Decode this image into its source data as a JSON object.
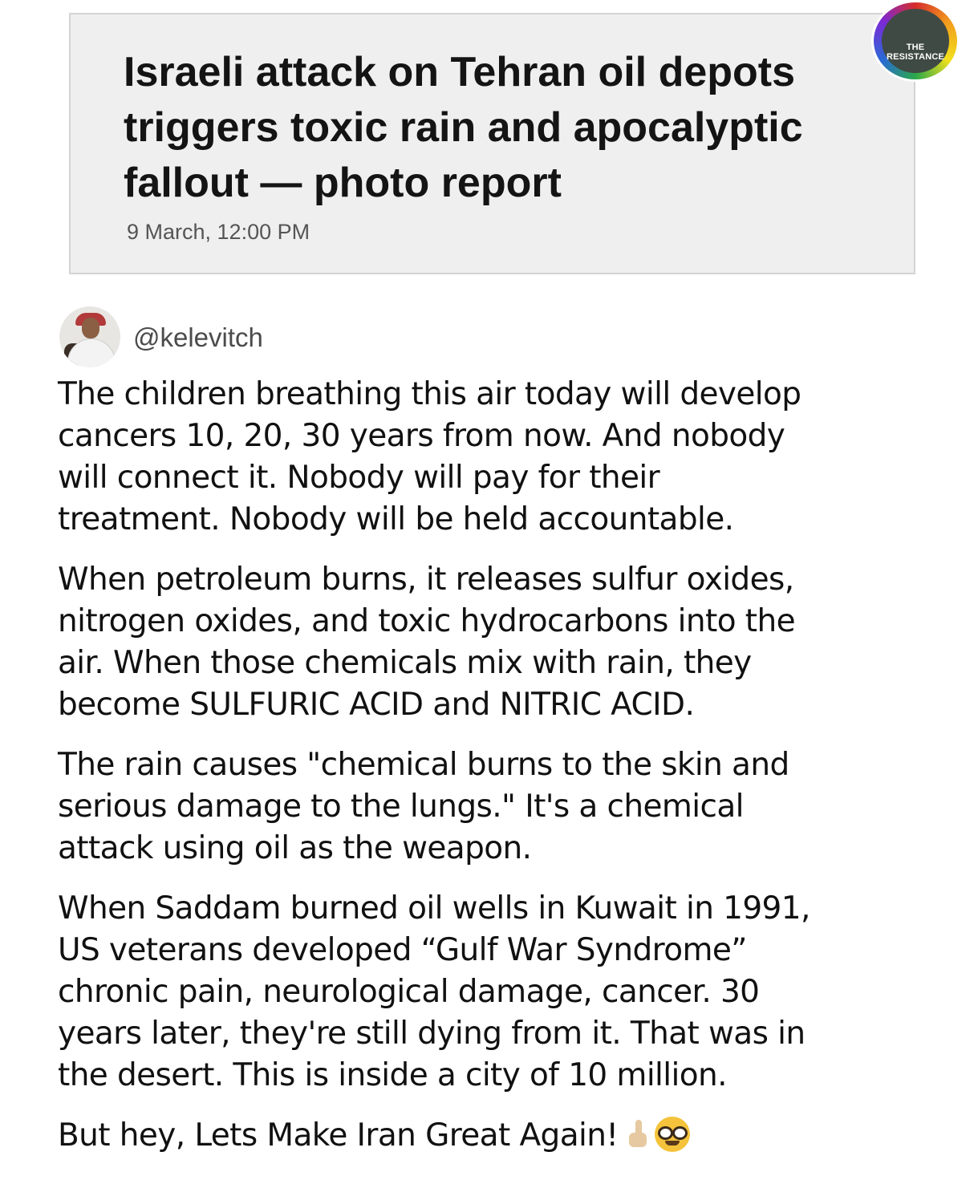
{
  "article_card": {
    "headline_lines": [
      "Israeli attack on Tehran oil depots",
      "triggers toxic rain and apocalyptic",
      "fallout — photo report"
    ],
    "timestamp": "9 March, 12:00 PM"
  },
  "badge": {
    "line1": "THE",
    "line2": "RESISTANCE"
  },
  "post": {
    "handle": "@kelevitch",
    "paragraphs": [
      [
        "The children breathing this air today will develop",
        "cancers 10, 20, 30 years from now. And nobody",
        "will connect it. Nobody will pay for their",
        "treatment. Nobody will be held accountable."
      ],
      [
        "When petroleum burns, it releases sulfur oxides,",
        "nitrogen oxides, and toxic hydrocarbons into the",
        "air. When those chemicals mix with rain, they",
        "become SULFURIC ACID and NITRIC ACID."
      ],
      [
        "The rain causes \"chemical burns to the skin and",
        "serious damage to the lungs.\" It's a chemical",
        "attack using oil as the weapon."
      ],
      [
        "When Saddam burned oil wells in Kuwait in 1991,",
        "US veterans developed “Gulf War Syndrome”",
        "chronic pain, neurological damage, cancer. 30",
        "years later, they're still dying from it. That was in",
        "the desert. This is inside a city of 10 million."
      ]
    ],
    "closing_line": "But hey, Lets Make Iran Great Again!",
    "closing_emojis": [
      "index-pointing-up-emoji",
      "nerd-face-emoji"
    ]
  }
}
